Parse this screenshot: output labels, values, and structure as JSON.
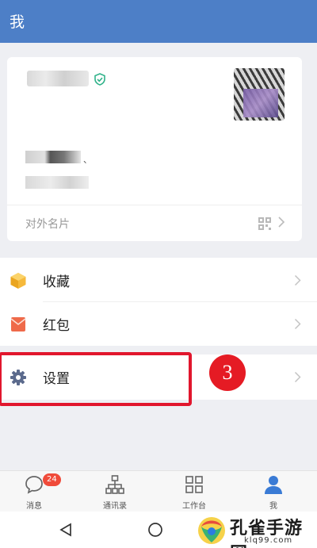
{
  "header": {
    "title": "我"
  },
  "profile": {
    "card_label": "对外名片",
    "info_trailing_mark": "、"
  },
  "menu": {
    "items": [
      {
        "label": "收藏",
        "icon": "box-icon"
      },
      {
        "label": "红包",
        "icon": "red-envelope-icon"
      },
      {
        "label": "设置",
        "icon": "gear-icon"
      }
    ]
  },
  "annotation": {
    "step_number": "3"
  },
  "tabbar": {
    "tabs": [
      {
        "label": "消息",
        "icon": "chat-bubble-icon",
        "badge": "24"
      },
      {
        "label": "通讯录",
        "icon": "org-chart-icon"
      },
      {
        "label": "工作台",
        "icon": "grid-icon"
      },
      {
        "label": "我",
        "icon": "person-icon"
      }
    ]
  },
  "watermark": {
    "title": "孔雀手游网",
    "subtitle": "klq99.com"
  },
  "colors": {
    "header_bg": "#4d7fc7",
    "highlight_red": "#e1162d",
    "badge_red": "#f04b3a",
    "active_tab_blue": "#3a7bd5"
  }
}
